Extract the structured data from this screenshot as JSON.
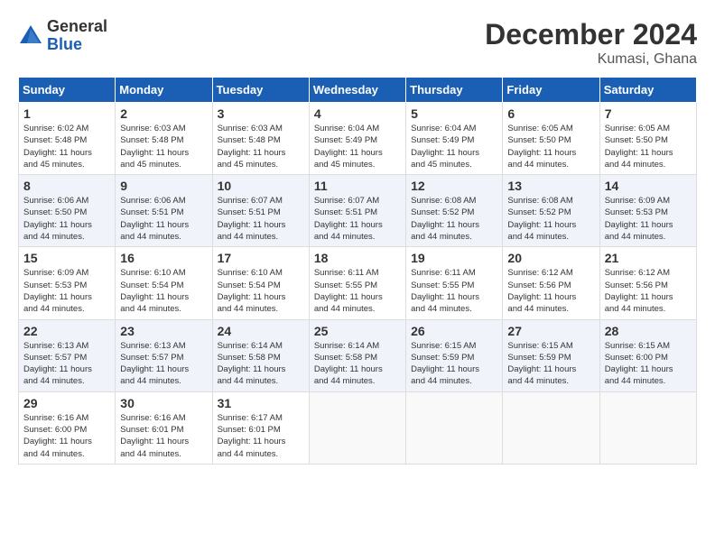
{
  "header": {
    "logo_general": "General",
    "logo_blue": "Blue",
    "month_title": "December 2024",
    "location": "Kumasi, Ghana"
  },
  "days_of_week": [
    "Sunday",
    "Monday",
    "Tuesday",
    "Wednesday",
    "Thursday",
    "Friday",
    "Saturday"
  ],
  "weeks": [
    [
      {
        "day": "1",
        "info": "Sunrise: 6:02 AM\nSunset: 5:48 PM\nDaylight: 11 hours\nand 45 minutes."
      },
      {
        "day": "2",
        "info": "Sunrise: 6:03 AM\nSunset: 5:48 PM\nDaylight: 11 hours\nand 45 minutes."
      },
      {
        "day": "3",
        "info": "Sunrise: 6:03 AM\nSunset: 5:48 PM\nDaylight: 11 hours\nand 45 minutes."
      },
      {
        "day": "4",
        "info": "Sunrise: 6:04 AM\nSunset: 5:49 PM\nDaylight: 11 hours\nand 45 minutes."
      },
      {
        "day": "5",
        "info": "Sunrise: 6:04 AM\nSunset: 5:49 PM\nDaylight: 11 hours\nand 45 minutes."
      },
      {
        "day": "6",
        "info": "Sunrise: 6:05 AM\nSunset: 5:50 PM\nDaylight: 11 hours\nand 44 minutes."
      },
      {
        "day": "7",
        "info": "Sunrise: 6:05 AM\nSunset: 5:50 PM\nDaylight: 11 hours\nand 44 minutes."
      }
    ],
    [
      {
        "day": "8",
        "info": "Sunrise: 6:06 AM\nSunset: 5:50 PM\nDaylight: 11 hours\nand 44 minutes."
      },
      {
        "day": "9",
        "info": "Sunrise: 6:06 AM\nSunset: 5:51 PM\nDaylight: 11 hours\nand 44 minutes."
      },
      {
        "day": "10",
        "info": "Sunrise: 6:07 AM\nSunset: 5:51 PM\nDaylight: 11 hours\nand 44 minutes."
      },
      {
        "day": "11",
        "info": "Sunrise: 6:07 AM\nSunset: 5:51 PM\nDaylight: 11 hours\nand 44 minutes."
      },
      {
        "day": "12",
        "info": "Sunrise: 6:08 AM\nSunset: 5:52 PM\nDaylight: 11 hours\nand 44 minutes."
      },
      {
        "day": "13",
        "info": "Sunrise: 6:08 AM\nSunset: 5:52 PM\nDaylight: 11 hours\nand 44 minutes."
      },
      {
        "day": "14",
        "info": "Sunrise: 6:09 AM\nSunset: 5:53 PM\nDaylight: 11 hours\nand 44 minutes."
      }
    ],
    [
      {
        "day": "15",
        "info": "Sunrise: 6:09 AM\nSunset: 5:53 PM\nDaylight: 11 hours\nand 44 minutes."
      },
      {
        "day": "16",
        "info": "Sunrise: 6:10 AM\nSunset: 5:54 PM\nDaylight: 11 hours\nand 44 minutes."
      },
      {
        "day": "17",
        "info": "Sunrise: 6:10 AM\nSunset: 5:54 PM\nDaylight: 11 hours\nand 44 minutes."
      },
      {
        "day": "18",
        "info": "Sunrise: 6:11 AM\nSunset: 5:55 PM\nDaylight: 11 hours\nand 44 minutes."
      },
      {
        "day": "19",
        "info": "Sunrise: 6:11 AM\nSunset: 5:55 PM\nDaylight: 11 hours\nand 44 minutes."
      },
      {
        "day": "20",
        "info": "Sunrise: 6:12 AM\nSunset: 5:56 PM\nDaylight: 11 hours\nand 44 minutes."
      },
      {
        "day": "21",
        "info": "Sunrise: 6:12 AM\nSunset: 5:56 PM\nDaylight: 11 hours\nand 44 minutes."
      }
    ],
    [
      {
        "day": "22",
        "info": "Sunrise: 6:13 AM\nSunset: 5:57 PM\nDaylight: 11 hours\nand 44 minutes."
      },
      {
        "day": "23",
        "info": "Sunrise: 6:13 AM\nSunset: 5:57 PM\nDaylight: 11 hours\nand 44 minutes."
      },
      {
        "day": "24",
        "info": "Sunrise: 6:14 AM\nSunset: 5:58 PM\nDaylight: 11 hours\nand 44 minutes."
      },
      {
        "day": "25",
        "info": "Sunrise: 6:14 AM\nSunset: 5:58 PM\nDaylight: 11 hours\nand 44 minutes."
      },
      {
        "day": "26",
        "info": "Sunrise: 6:15 AM\nSunset: 5:59 PM\nDaylight: 11 hours\nand 44 minutes."
      },
      {
        "day": "27",
        "info": "Sunrise: 6:15 AM\nSunset: 5:59 PM\nDaylight: 11 hours\nand 44 minutes."
      },
      {
        "day": "28",
        "info": "Sunrise: 6:15 AM\nSunset: 6:00 PM\nDaylight: 11 hours\nand 44 minutes."
      }
    ],
    [
      {
        "day": "29",
        "info": "Sunrise: 6:16 AM\nSunset: 6:00 PM\nDaylight: 11 hours\nand 44 minutes."
      },
      {
        "day": "30",
        "info": "Sunrise: 6:16 AM\nSunset: 6:01 PM\nDaylight: 11 hours\nand 44 minutes."
      },
      {
        "day": "31",
        "info": "Sunrise: 6:17 AM\nSunset: 6:01 PM\nDaylight: 11 hours\nand 44 minutes."
      },
      {
        "day": "",
        "info": ""
      },
      {
        "day": "",
        "info": ""
      },
      {
        "day": "",
        "info": ""
      },
      {
        "day": "",
        "info": ""
      }
    ]
  ]
}
